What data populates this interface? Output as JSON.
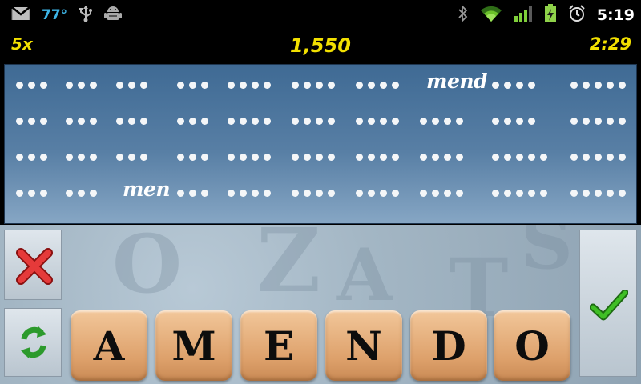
{
  "status_bar": {
    "icons_left": [
      "gmail-icon",
      "usb-icon",
      "android-debug-icon"
    ],
    "temperature": "77°",
    "icons_right": [
      "bluetooth-icon",
      "wifi-icon",
      "signal-icon",
      "battery-charging-icon",
      "alarm-icon"
    ],
    "time": "5:19"
  },
  "score_bar": {
    "multiplier": "5x",
    "score": "1,550",
    "timer": "2:29"
  },
  "board": {
    "found_words": [
      "mend",
      "men"
    ],
    "rows": [
      [
        3,
        3,
        3,
        3,
        4,
        4,
        4,
        "mend",
        4,
        5
      ],
      [
        3,
        3,
        3,
        3,
        4,
        4,
        4,
        4,
        4,
        5
      ],
      [
        3,
        3,
        3,
        3,
        4,
        4,
        4,
        4,
        5,
        5
      ],
      [
        3,
        3,
        "men",
        3,
        4,
        4,
        4,
        4,
        5,
        5
      ]
    ]
  },
  "controls": {
    "clear_icon": "red-x-icon",
    "shuffle_icon": "recycle-arrows-icon",
    "submit_icon": "green-checkmark-icon"
  },
  "tiles": [
    "A",
    "M",
    "E",
    "N",
    "D",
    "O"
  ],
  "colors": {
    "score_text": "#f2e000",
    "board_top": "#3f6a94",
    "tile": "#dda06a"
  }
}
